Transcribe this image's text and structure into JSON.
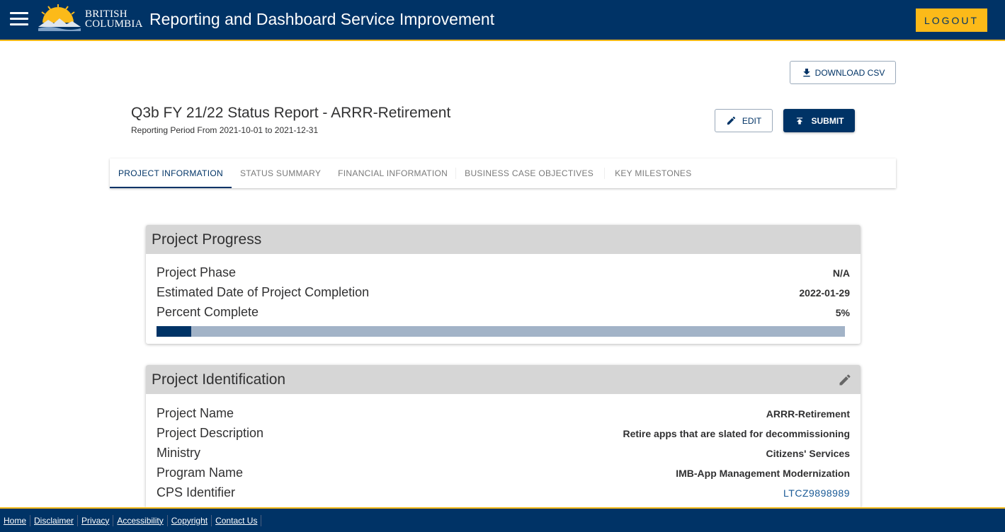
{
  "header": {
    "logo_line1": "BRITISH",
    "logo_line2": "COLUMBIA",
    "app_title": "Reporting and Dashboard Service Improvement",
    "logout_label": "LOGOUT"
  },
  "toolbar": {
    "download_label": "DOWNLOAD CSV",
    "edit_label": "EDIT",
    "submit_label": "SUBMIT"
  },
  "report": {
    "title": "Q3b FY 21/22 Status Report - ARRR-Retirement",
    "period": "Reporting Period From 2021-10-01 to 2021-12-31"
  },
  "tabs": [
    {
      "label": "PROJECT INFORMATION",
      "active": true
    },
    {
      "label": "STATUS SUMMARY",
      "active": false
    },
    {
      "label": "FINANCIAL INFORMATION",
      "active": false
    },
    {
      "label": "BUSINESS CASE OBJECTIVES",
      "active": false
    },
    {
      "label": "KEY MILESTONES",
      "active": false
    }
  ],
  "project_progress": {
    "heading": "Project Progress",
    "phase_label": "Project Phase",
    "phase_value": "N/A",
    "completion_label": "Estimated Date of Project Completion",
    "completion_value": "2022-01-29",
    "percent_label": "Percent Complete",
    "percent_value": "5%",
    "percent_fraction": 0.05
  },
  "project_identification": {
    "heading": "Project Identification",
    "name_label": "Project Name",
    "name_value": "ARRR-Retirement",
    "description_label": "Project Description",
    "description_value": "Retire apps that are slated for decommissioning",
    "ministry_label": "Ministry",
    "ministry_value": "Citizens' Services",
    "program_label": "Program Name",
    "program_value": "IMB-App Management Modernization",
    "cps_label": "CPS Identifier",
    "cps_value": "LTCZ9898989"
  },
  "footer": {
    "links": [
      "Home",
      "Disclaimer",
      "Privacy",
      "Accessibility",
      "Copyright",
      "Contact Us"
    ]
  },
  "colors": {
    "primary": "#003366",
    "accent": "#fcba19",
    "card_header": "#d6d6d6",
    "progress_track": "#a2b3c7"
  },
  "icons": {
    "menu": "hamburger-menu-icon",
    "download": "download-icon",
    "edit": "pencil-icon",
    "submit": "upload-icon"
  }
}
